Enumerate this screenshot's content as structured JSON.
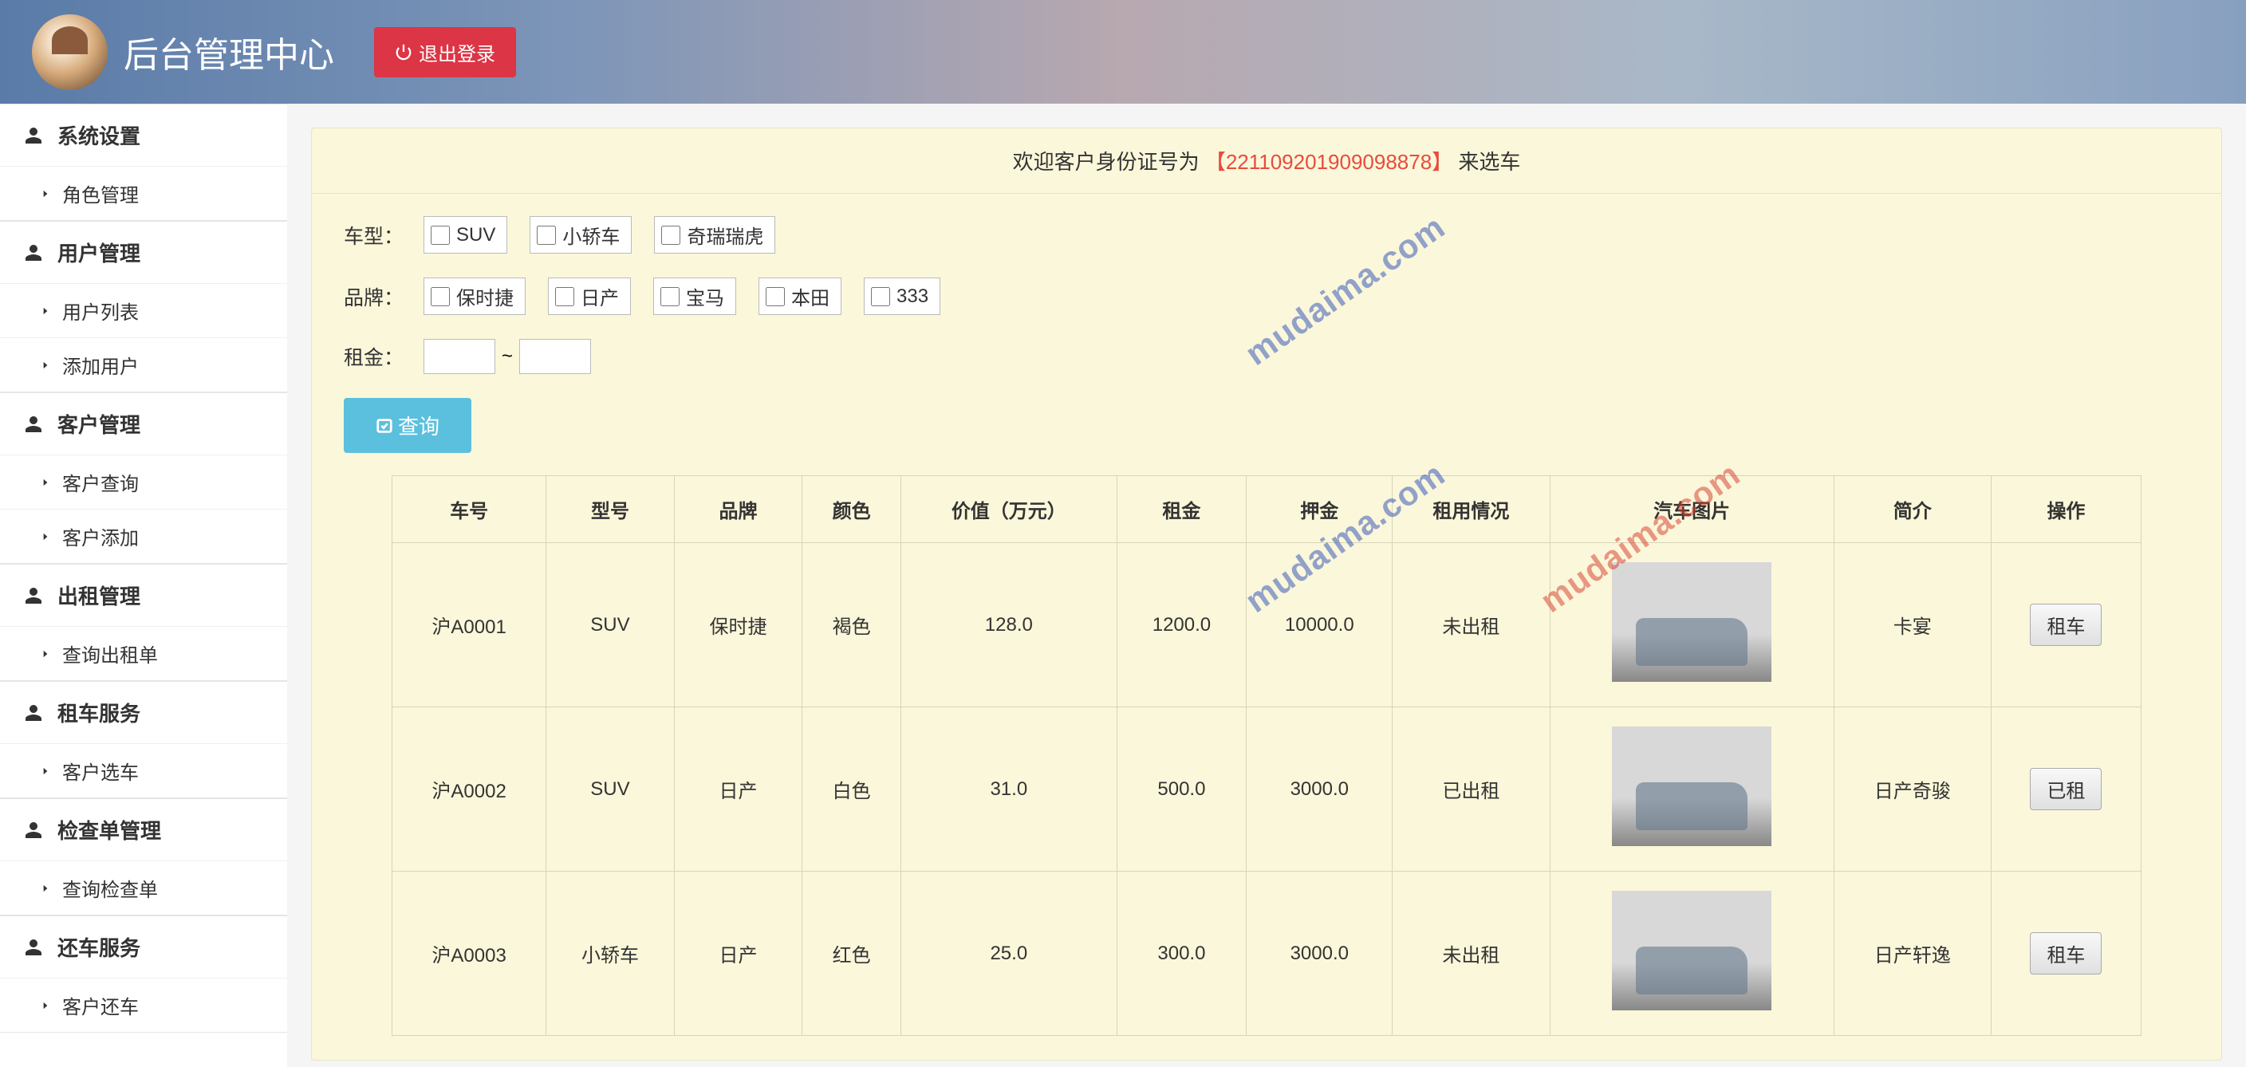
{
  "header": {
    "title": "后台管理中心",
    "logout_label": "退出登录"
  },
  "sidebar": {
    "sections": [
      {
        "title": "系统设置",
        "items": [
          {
            "label": "角色管理"
          }
        ]
      },
      {
        "title": "用户管理",
        "items": [
          {
            "label": "用户列表"
          },
          {
            "label": "添加用户"
          }
        ]
      },
      {
        "title": "客户管理",
        "items": [
          {
            "label": "客户查询"
          },
          {
            "label": "客户添加"
          }
        ]
      },
      {
        "title": "出租管理",
        "items": [
          {
            "label": "查询出租单"
          }
        ]
      },
      {
        "title": "租车服务",
        "items": [
          {
            "label": "客户选车"
          }
        ]
      },
      {
        "title": "检查单管理",
        "items": [
          {
            "label": "查询检查单"
          }
        ]
      },
      {
        "title": "还车服务",
        "items": [
          {
            "label": "客户还车"
          }
        ]
      }
    ]
  },
  "panel": {
    "welcome_prefix": "欢迎客户身份证号为",
    "welcome_id": "【221109201909098878】",
    "welcome_suffix": "来选车",
    "filters": {
      "type_label": "车型：",
      "type_options": [
        "SUV",
        "小轿车",
        "奇瑞瑞虎"
      ],
      "brand_label": "品牌：",
      "brand_options": [
        "保时捷",
        "日产",
        "宝马",
        "本田",
        "333"
      ],
      "price_label": "租金：",
      "price_sep": "~",
      "search_label": "查询"
    }
  },
  "table": {
    "headers": [
      "车号",
      "型号",
      "品牌",
      "颜色",
      "价值（万元）",
      "租金",
      "押金",
      "租用情况",
      "汽车图片",
      "简介",
      "操作"
    ],
    "rows": [
      {
        "plate": "沪A0001",
        "type": "SUV",
        "brand": "保时捷",
        "color": "褐色",
        "value": "128.0",
        "rent": "1200.0",
        "deposit": "10000.0",
        "status": "未出租",
        "desc": "卡宴",
        "action": "租车",
        "action_disabled": false
      },
      {
        "plate": "沪A0002",
        "type": "SUV",
        "brand": "日产",
        "color": "白色",
        "value": "31.0",
        "rent": "500.0",
        "deposit": "3000.0",
        "status": "已出租",
        "desc": "日产奇骏",
        "action": "已租",
        "action_disabled": false
      },
      {
        "plate": "沪A0003",
        "type": "小轿车",
        "brand": "日产",
        "color": "红色",
        "value": "25.0",
        "rent": "300.0",
        "deposit": "3000.0",
        "status": "未出租",
        "desc": "日产轩逸",
        "action": "租车",
        "action_disabled": false
      }
    ]
  },
  "watermark": "mudaima.com"
}
